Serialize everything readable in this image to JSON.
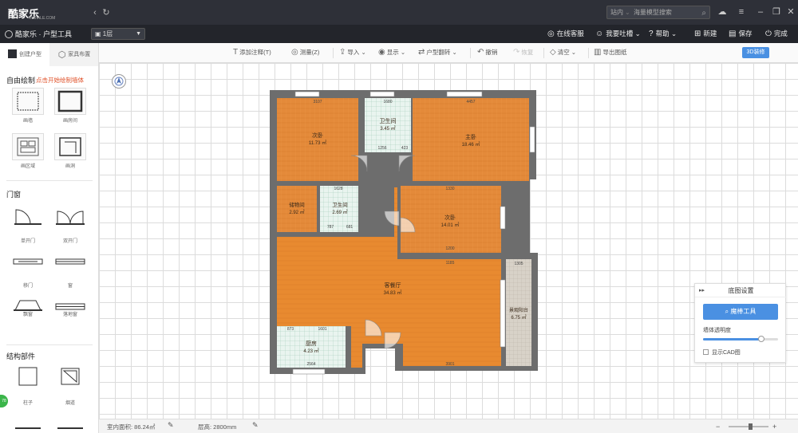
{
  "titlebar": {
    "logo": "酷家乐",
    "logo_sub": "KUJIALE.COM",
    "search_scope": "站内",
    "search_placeholder": "海量模型搜索"
  },
  "appbar": {
    "brand": "酷家乐 · 户型工具",
    "floor": "1层",
    "buttons": {
      "service": "在线客服",
      "feedback": "我要吐槽",
      "help": "帮助",
      "new": "新建",
      "save": "保存",
      "done": "完成"
    }
  },
  "leftpanel": {
    "tabs": [
      "创建户型",
      "家具布置"
    ],
    "sections": {
      "free_draw": {
        "title": "自由绘制",
        "hint": "点击开始绘制墙体",
        "tools": [
          "画墙",
          "画房间",
          "画区域",
          "画洞"
        ]
      },
      "doors": {
        "title": "门窗",
        "tools": [
          "单开门",
          "双开门",
          "移门",
          "窗",
          "飘窗",
          "落地窗"
        ]
      },
      "structure": {
        "title": "结构部件",
        "tools": [
          "柱子",
          "烟道"
        ]
      }
    }
  },
  "toolbar": {
    "items": [
      "添加注释(T)",
      "测量(Z)",
      "导入",
      "显示",
      "户型翻转",
      "撤销",
      "恢复",
      "清空",
      "导出图纸",
      "3D装修"
    ]
  },
  "floorplan": {
    "rooms": [
      {
        "name": "次卧",
        "area": "11.73 ㎡"
      },
      {
        "name": "卫生间",
        "area": "3.45 ㎡"
      },
      {
        "name": "主卧",
        "area": "18.46 ㎡"
      },
      {
        "name": "储物间",
        "area": "2.92 ㎡"
      },
      {
        "name": "卫生间",
        "area": "2.69 ㎡"
      },
      {
        "name": "次卧",
        "area": "14.01 ㎡"
      },
      {
        "name": "客餐厅",
        "area": "34.83 ㎡"
      },
      {
        "name": "厨房",
        "area": "4.23 ㎡"
      },
      {
        "name": "景观阳台",
        "area": "6.75 ㎡"
      }
    ],
    "dims": [
      "3107",
      "1680",
      "4457",
      "1256",
      "423",
      "1628",
      "787",
      "681",
      "873",
      "1601",
      "2564",
      "3901",
      "1330",
      "1200",
      "1185",
      "1305"
    ]
  },
  "bgpanel": {
    "title": "底图设置",
    "button": "魔棒工具",
    "opacity_label": "墙体透明度",
    "opacity": 0.78,
    "cad_label": "显示CAD图"
  },
  "bottombar": {
    "area": "室内面积: 86.24㎡",
    "height": "层高: 2800mm"
  },
  "badge": "78"
}
